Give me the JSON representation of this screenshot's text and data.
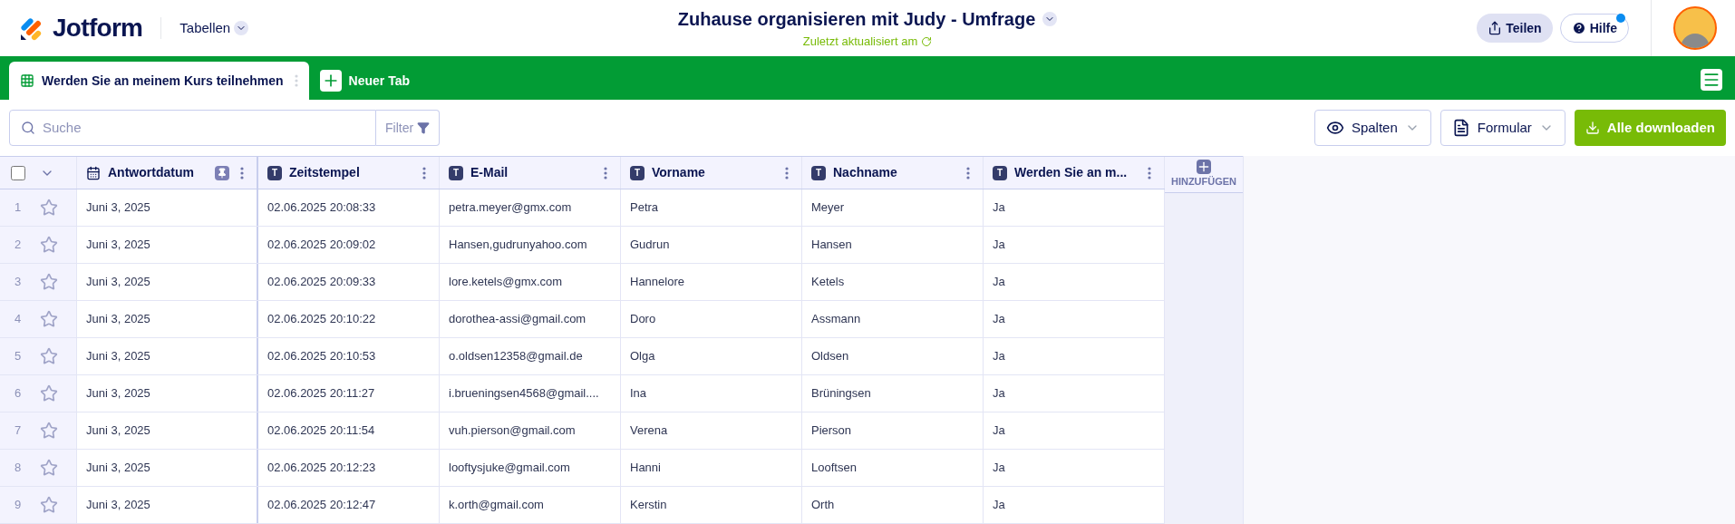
{
  "header": {
    "brand": "Jotform",
    "menu": "Tabellen",
    "title": "Zuhause organisieren mit Judy - Umfrage",
    "subtitle": "Zuletzt aktualisiert am",
    "share": "Teilen",
    "help": "Hilfe",
    "help_notification": true
  },
  "tabs": [
    {
      "label": "Werden Sie an meinem Kurs teilnehmen",
      "selected": true
    }
  ],
  "new_tab": "Neuer Tab",
  "toolbar": {
    "search": {
      "placeholder": "Suche"
    },
    "filter": "Filter",
    "columns_button": "Spalten",
    "form_button": "Formular",
    "download_button": "Alle downloaden"
  },
  "table": {
    "select_all": false,
    "columns": [
      {
        "kind": "date",
        "label": "Antwortdatum",
        "pinned": true
      },
      {
        "kind": "text",
        "type_glyph": "T",
        "label": "Zeitstempel",
        "pinned": false
      },
      {
        "kind": "text",
        "type_glyph": "T",
        "label": "E-Mail",
        "pinned": false
      },
      {
        "kind": "text",
        "type_glyph": "T",
        "label": "Vorname",
        "pinned": false
      },
      {
        "kind": "text",
        "type_glyph": "T",
        "label": "Nachname",
        "pinned": false
      },
      {
        "kind": "text",
        "type_glyph": "T",
        "label": "Werden Sie an m...",
        "pinned": false
      }
    ],
    "add_column": "HINZUFÜGEN",
    "rows": [
      {
        "number": "1",
        "starred": false,
        "cells": [
          "Juni 3, 2025",
          "02.06.2025 20:08:33",
          "petra.meyer@gmx.com",
          "Petra",
          "Meyer",
          "Ja"
        ]
      },
      {
        "number": "2",
        "starred": false,
        "cells": [
          "Juni 3, 2025",
          "02.06.2025 20:09:02",
          "Hansen,gudrunyahoo.com",
          "Gudrun",
          "Hansen",
          "Ja"
        ]
      },
      {
        "number": "3",
        "starred": false,
        "cells": [
          "Juni 3, 2025",
          "02.06.2025 20:09:33",
          "lore.ketels@gmx.com",
          "Hannelore",
          "Ketels",
          "Ja"
        ]
      },
      {
        "number": "4",
        "starred": false,
        "cells": [
          "Juni 3, 2025",
          "02.06.2025 20:10:22",
          "dorothea-assi@gmail.com",
          "Doro",
          "Assmann",
          "Ja"
        ]
      },
      {
        "number": "5",
        "starred": false,
        "cells": [
          "Juni 3, 2025",
          "02.06.2025 20:10:53",
          "o.oldsen12358@gmail.de",
          "Olga",
          "Oldsen",
          "Ja"
        ]
      },
      {
        "number": "6",
        "starred": false,
        "cells": [
          "Juni 3, 2025",
          "02.06.2025 20:11:27",
          "i.brueningsen4568@gmail....",
          "Ina",
          "Brüningsen",
          "Ja"
        ]
      },
      {
        "number": "7",
        "starred": false,
        "cells": [
          "Juni 3, 2025",
          "02.06.2025 20:11:54",
          "vuh.pierson@gmail.com",
          "Verena",
          "Pierson",
          "Ja"
        ]
      },
      {
        "number": "8",
        "starred": false,
        "cells": [
          "Juni 3, 2025",
          "02.06.2025 20:12:23",
          "looftysjuke@gmail.com",
          "Hanni",
          "Looftsen",
          "Ja"
        ]
      },
      {
        "number": "9",
        "starred": false,
        "cells": [
          "Juni 3, 2025",
          "02.06.2025 20:12:47",
          "k.orth@gmail.com",
          "Kerstin",
          "Orth",
          "Ja"
        ]
      }
    ]
  }
}
